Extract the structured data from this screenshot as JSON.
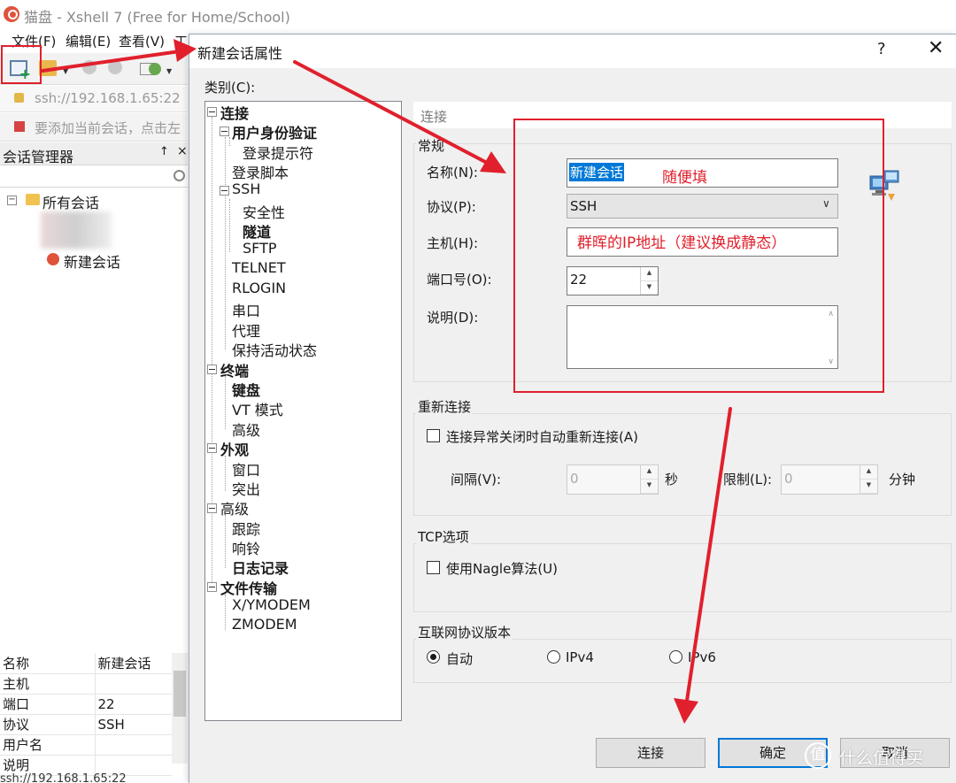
{
  "main_window": {
    "title": "猫盘 - Xshell 7 (Free for Home/School)",
    "menu": [
      "文件(F)",
      "编辑(E)",
      "查看(V)",
      "工"
    ],
    "address": "ssh://192.168.1.65:22",
    "hint": "要添加当前会话，点击左",
    "session_manager": {
      "title": "会话管理器",
      "pin_glyph": "↑",
      "close_glyph": "×",
      "tree": {
        "root": "所有会话",
        "new_session": "新建会话"
      }
    },
    "properties": [
      {
        "key": "名称",
        "value": "新建会话"
      },
      {
        "key": "主机",
        "value": ""
      },
      {
        "key": "端口",
        "value": "22"
      },
      {
        "key": "协议",
        "value": "SSH"
      },
      {
        "key": "用户名",
        "value": ""
      },
      {
        "key": "说明",
        "value": ""
      }
    ],
    "status": "ssh://192.168.1.65:22"
  },
  "dialog": {
    "title": "新建会话属性",
    "help_glyph": "?",
    "close_glyph": "✕",
    "category_label": "类别(C):",
    "categories": {
      "connection": "连接",
      "auth": "用户身份验证",
      "login_prompt": "登录提示符",
      "login_script": "登录脚本",
      "ssh": "SSH",
      "security": "安全性",
      "tunnel": "隧道",
      "sftp": "SFTP",
      "telnet": "TELNET",
      "rlogin": "RLOGIN",
      "serial": "串口",
      "proxy": "代理",
      "keepalive": "保持活动状态",
      "terminal": "终端",
      "keyboard": "键盘",
      "vt_mode": "VT 模式",
      "advanced": "高级",
      "appearance": "外观",
      "window": "窗口",
      "highlight": "突出",
      "advanced2": "高级",
      "trace": "跟踪",
      "bell": "响铃",
      "logging": "日志记录",
      "file_transfer": "文件传输",
      "xymodem": "X/YMODEM",
      "zmodem": "ZMODEM"
    },
    "panel_title": "连接",
    "general": {
      "title": "常规",
      "name_label": "名称(N):",
      "name_value": "新建会话",
      "protocol_label": "协议(P):",
      "protocol_value": "SSH",
      "host_label": "主机(H):",
      "host_value": "",
      "port_label": "端口号(O):",
      "port_value": "22",
      "desc_label": "说明(D):",
      "desc_value": ""
    },
    "reconnect": {
      "title": "重新连接",
      "checkbox_label": "连接异常关闭时自动重新连接(A)",
      "checked": false,
      "interval_label": "间隔(V):",
      "interval_value": "0",
      "interval_unit": "秒",
      "limit_label": "限制(L):",
      "limit_value": "0",
      "limit_unit": "分钟"
    },
    "tcp": {
      "title": "TCP选项",
      "nagle_label": "使用Nagle算法(U)",
      "checked": false
    },
    "ip_version": {
      "title": "互联网协议版本",
      "options": [
        "自动",
        "IPv4",
        "IPv6"
      ],
      "selected": "自动"
    },
    "buttons": {
      "connect": "连接",
      "ok": "确定",
      "cancel": "取消"
    }
  },
  "annotations": {
    "name_hint": "随便填",
    "host_hint": "群晖的IP地址（建议换成静态）"
  },
  "watermark": {
    "logo": "值",
    "text": "什么值得买"
  },
  "colors": {
    "annotation": "#e0202c",
    "dialog_bg": "#f0f0f0",
    "selection": "#0078d7"
  }
}
